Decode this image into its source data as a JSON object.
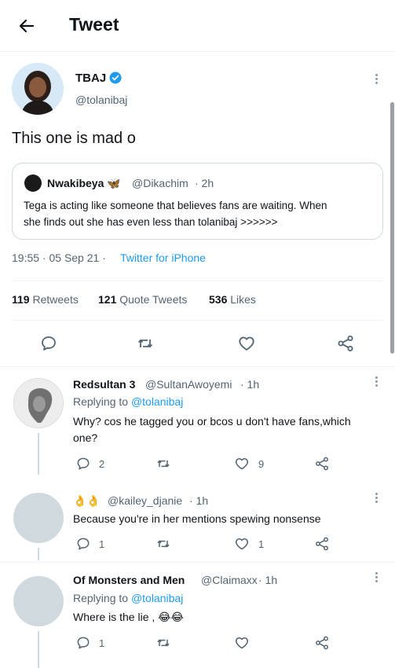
{
  "header": {
    "title": "Tweet"
  },
  "main_tweet": {
    "name": "TBAJ",
    "handle": "@tolanibaj",
    "text": "This one is mad o",
    "quoted": {
      "name": "Nwakibeya 🦋",
      "handle": "@Dikachim",
      "time": "· 2h",
      "text_line1": "Tega is acting like someone that believes fans are waiting. When",
      "text_line2": "she finds out she has even less than tolanibaj >>>>>>"
    },
    "time": "19:55 · 05 Sep 21 ·",
    "source": "Twitter for iPhone",
    "stats": {
      "retweets_count": "119",
      "retweets_label": "Retweets",
      "quotes_count": "121",
      "quotes_label": "Quote Tweets",
      "likes_count": "536",
      "likes_label": "Likes"
    },
    "verified_color": "#1d9bf0"
  },
  "replies": [
    {
      "name": "Redsultan 3",
      "handle": "@SultanAwoyemi",
      "time": "· 1h",
      "replying_prefix": "Replying to",
      "replying_to": "@tolanibaj",
      "text_line1": "Why? cos he tagged you or bcos u don't have fans,which",
      "text_line2": "one?",
      "reply_count": "2",
      "retweet_count": "",
      "like_count": "9"
    },
    {
      "name": "👌👌",
      "handle": "@kailey_djanie",
      "time": "· 1h",
      "text_line1": "Because you're in her mentions spewing nonsense",
      "reply_count": "1",
      "retweet_count": "",
      "like_count": "1"
    },
    {
      "name": "Of Monsters and Men",
      "handle": "@Claimaxx",
      "time": "· 1h",
      "replying_prefix": "Replying to",
      "replying_to": "@tolanibaj",
      "text_line1": "Where is the lie , 😂😂",
      "reply_count": "1",
      "retweet_count": "",
      "like_count": ""
    }
  ],
  "icons": {
    "back": "arrow-left-icon",
    "verified": "verified-badge-icon",
    "reply": "reply-icon",
    "retweet": "retweet-icon",
    "like": "heart-icon",
    "share": "share-icon",
    "more": "more-icon"
  }
}
